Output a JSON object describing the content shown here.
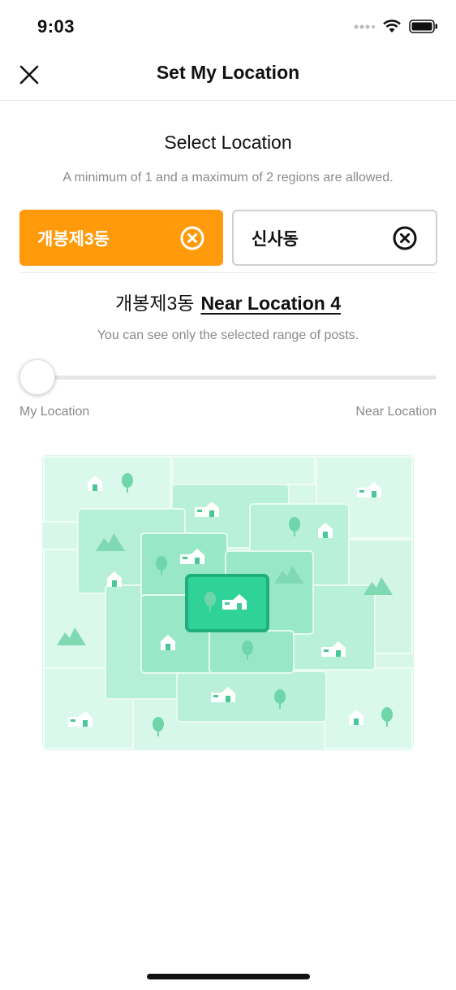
{
  "status_bar": {
    "time": "9:03"
  },
  "header": {
    "title": "Set My Location"
  },
  "location": {
    "title": "Select Location",
    "subtitle": "A minimum of 1 and a maximum of 2 regions are allowed.",
    "regions": [
      {
        "label": "개봉제3동",
        "selected": true
      },
      {
        "label": "신사동",
        "selected": false
      }
    ]
  },
  "range": {
    "region": "개봉제3동",
    "label": "Near Location 4",
    "hint": "You can see only the selected range of posts.",
    "min_label": "My Location",
    "max_label": "Near Location",
    "level": 0
  },
  "colors": {
    "accent": "#ff9a0a",
    "map_light": "#d9f8eb",
    "map_mid": "#a9ecd3",
    "map_dark": "#2fd39a"
  }
}
